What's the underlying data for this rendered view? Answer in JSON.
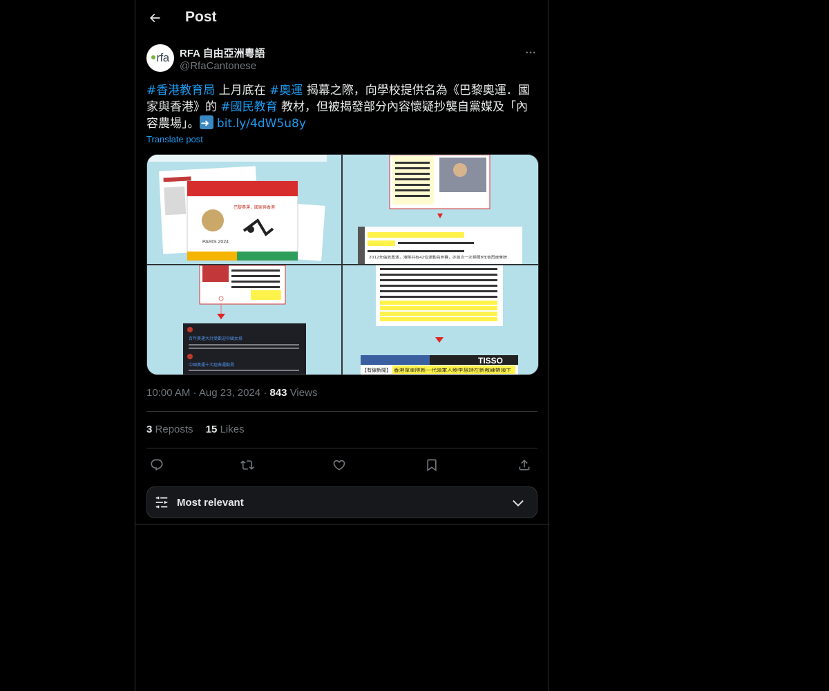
{
  "header": {
    "title": "Post"
  },
  "post": {
    "author": {
      "display_name": "RFA 自由亞洲粵語",
      "handle": "@RfaCantonese",
      "avatar_text": "rfa"
    },
    "text": {
      "tag1": "#香港教育局",
      "seg1": " 上月底在 ",
      "tag2": "#奧運",
      "seg2": " 揭幕之際，向學校提供名為《巴黎奧運．國家與香港》的 ",
      "tag3": "#國民教育",
      "seg3": " 教材，但被揭發部分內容懷疑抄襲自黨媒及「內容農場」。",
      "link": "bit.ly/4dW5u8y"
    },
    "translate_label": "Translate post",
    "time": "10:00 AM",
    "date": "Aug 23, 2024",
    "views_count": "843",
    "views_label": "Views",
    "reposts_count": "3",
    "reposts_label": "Reposts",
    "likes_count": "15",
    "likes_label": "Likes",
    "media_texts": {
      "book_title": "巴黎奧運．國家與香港",
      "paris_label": "PARIS 2024",
      "highlight_top": "2012年倫敦奧運，港隊共有42位運動員參賽，亦首次一次相隔8年後再度奪牌",
      "highlight_bottom": "香港單車隊新一代領軍人物李慧詩在新教練帶領下",
      "news_tag": "【有線新聞】",
      "news_title1": "百年奧運大計受歡迎中國女排",
      "news_title2": "中國奧運十大經典運動員",
      "tissot": "TISSO"
    }
  },
  "sort": {
    "label": "Most relevant"
  },
  "colors": {
    "accent": "#1d9bf0",
    "background": "#000000",
    "border": "#2f3336",
    "muted": "#71767b"
  }
}
